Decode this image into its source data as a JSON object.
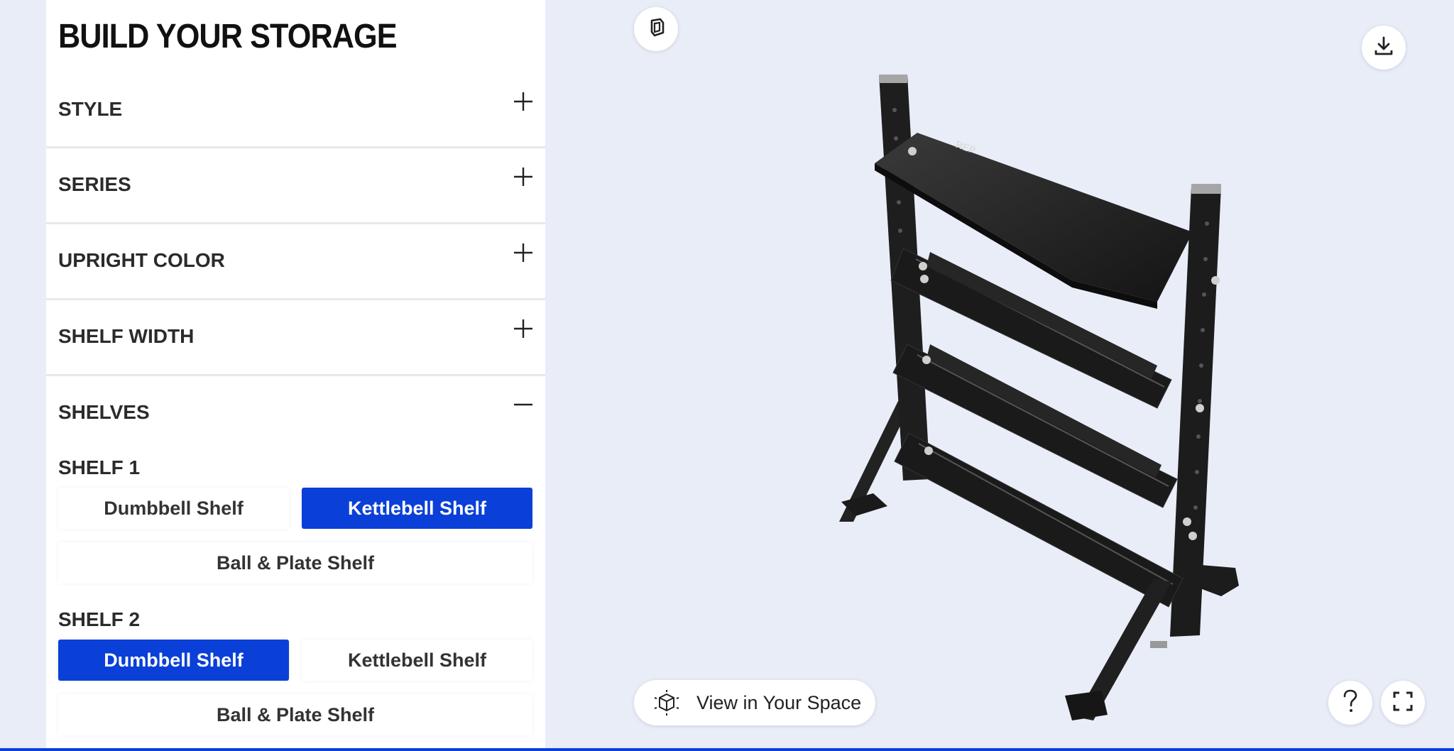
{
  "configurator": {
    "title": "BUILD YOUR STORAGE",
    "sections": [
      {
        "label": "STYLE",
        "expanded": false
      },
      {
        "label": "SERIES",
        "expanded": false
      },
      {
        "label": "UPRIGHT COLOR",
        "expanded": false
      },
      {
        "label": "SHELF WIDTH",
        "expanded": false
      },
      {
        "label": "SHELVES",
        "expanded": true
      }
    ],
    "shelves": [
      {
        "heading": "SHELF 1",
        "options": [
          "Dumbbell Shelf",
          "Kettlebell Shelf",
          "Ball & Plate Shelf"
        ],
        "selected": "Kettlebell Shelf"
      },
      {
        "heading": "SHELF 2",
        "options": [
          "Dumbbell Shelf",
          "Kettlebell Shelf",
          "Ball & Plate Shelf"
        ],
        "selected": "Dumbbell Shelf"
      }
    ]
  },
  "viewer": {
    "ar_button_label": "View in Your Space",
    "rack_brand_text": "REP",
    "icons": {
      "top_left": "3d-model-icon",
      "top_right": "download-icon",
      "ar": "ar-cube-icon",
      "help": "question-mark-icon",
      "fullscreen": "fullscreen-icon"
    }
  },
  "colors": {
    "accent": "#0a3fd8",
    "background": "#e8edf8",
    "panel": "#ffffff",
    "rack": "#1c1c1c"
  }
}
